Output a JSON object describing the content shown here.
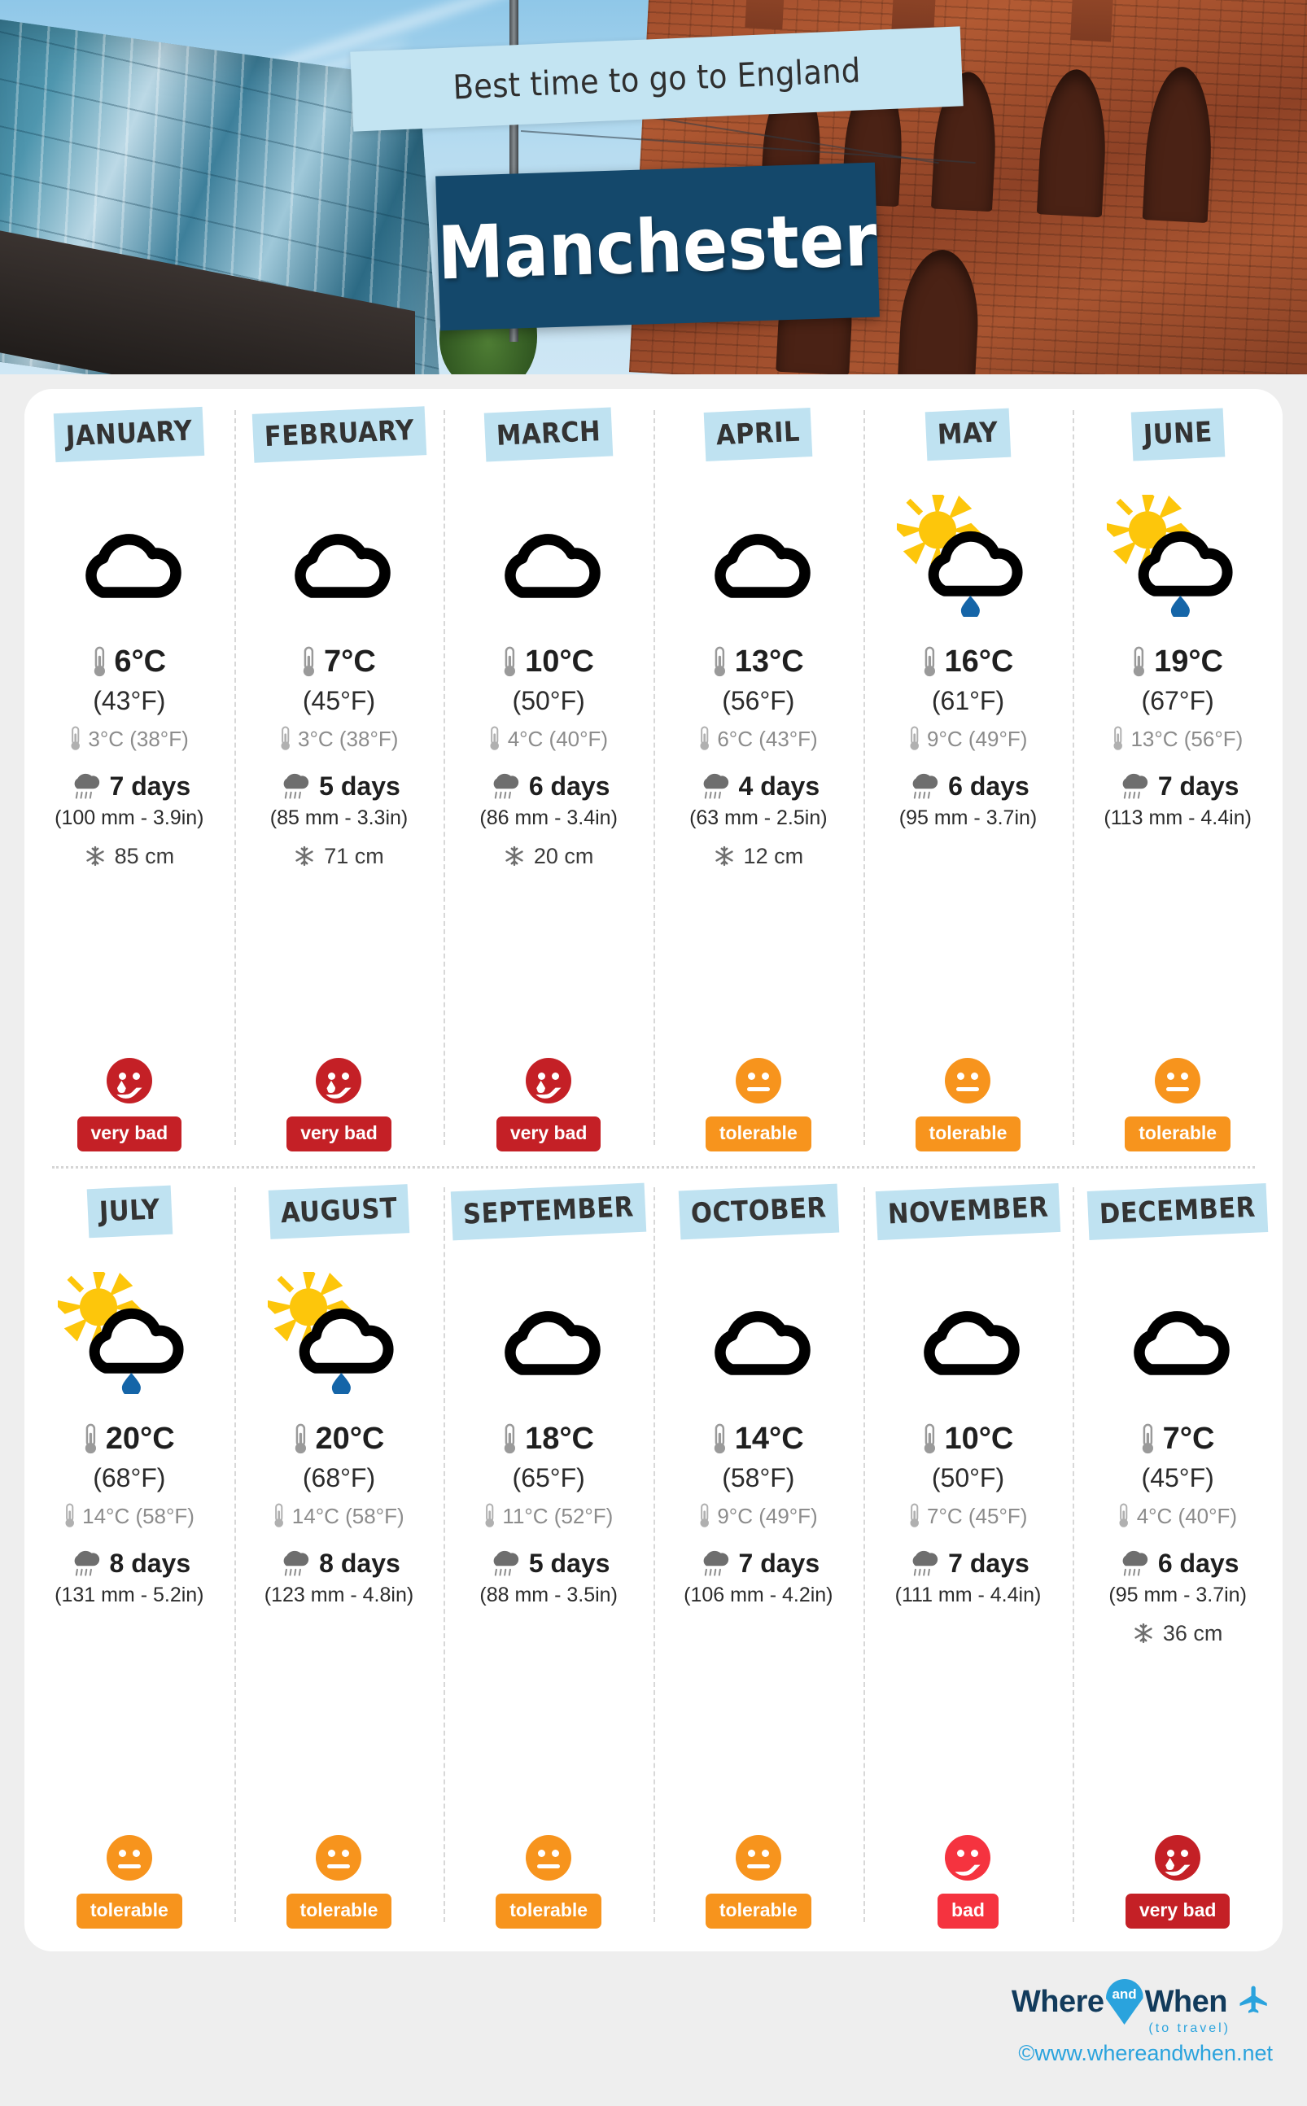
{
  "hero": {
    "subtitle": "Best time to go to England",
    "city": "Manchester"
  },
  "colors": {
    "accent_blue": "#bfe2f1",
    "band_dark_blue": "#14486b",
    "tolerable_orange": "#f7941d",
    "bad_red": "#f5333f",
    "very_bad_red": "#c42026",
    "raindrop_blue": "#1565a8",
    "sun_yellow": "#fdc60b",
    "logo_blue": "#2aa3dd",
    "logo_navy": "#123b5c"
  },
  "icons": {
    "thermometer": "thermometer-icon",
    "thermometer_low": "thermometer-low-icon",
    "rain_cloud": "rain-cloud-icon",
    "snowflake": "snowflake-icon",
    "cloud": "cloud-icon",
    "sun_cloud_rain": "sun-cloud-rain-icon"
  },
  "months": [
    {
      "name": "JANUARY",
      "weather_icon": "cloud",
      "temp_high_c": "6°C",
      "temp_high_f": "(43°F)",
      "temp_low": "3°C (38°F)",
      "rain_days": "7 days",
      "rain_amount": "(100 mm - 3.9in)",
      "snow": "85 cm",
      "rating": "very bad",
      "rating_face": "crying",
      "rating_color": "#c42026"
    },
    {
      "name": "FEBRUARY",
      "weather_icon": "cloud",
      "temp_high_c": "7°C",
      "temp_high_f": "(45°F)",
      "temp_low": "3°C (38°F)",
      "rain_days": "5 days",
      "rain_amount": "(85 mm - 3.3in)",
      "snow": "71 cm",
      "rating": "very bad",
      "rating_face": "crying",
      "rating_color": "#c42026"
    },
    {
      "name": "MARCH",
      "weather_icon": "cloud",
      "temp_high_c": "10°C",
      "temp_high_f": "(50°F)",
      "temp_low": "4°C (40°F)",
      "rain_days": "6 days",
      "rain_amount": "(86 mm - 3.4in)",
      "snow": "20 cm",
      "rating": "very bad",
      "rating_face": "crying",
      "rating_color": "#c42026"
    },
    {
      "name": "APRIL",
      "weather_icon": "cloud",
      "temp_high_c": "13°C",
      "temp_high_f": "(56°F)",
      "temp_low": "6°C (43°F)",
      "rain_days": "4 days",
      "rain_amount": "(63 mm - 2.5in)",
      "snow": "12 cm",
      "rating": "tolerable",
      "rating_face": "neutral",
      "rating_color": "#f7941d"
    },
    {
      "name": "MAY",
      "weather_icon": "sun_cloud_rain",
      "temp_high_c": "16°C",
      "temp_high_f": "(61°F)",
      "temp_low": "9°C (49°F)",
      "rain_days": "6 days",
      "rain_amount": "(95 mm - 3.7in)",
      "snow": "",
      "rating": "tolerable",
      "rating_face": "neutral",
      "rating_color": "#f7941d"
    },
    {
      "name": "JUNE",
      "weather_icon": "sun_cloud_rain",
      "temp_high_c": "19°C",
      "temp_high_f": "(67°F)",
      "temp_low": "13°C (56°F)",
      "rain_days": "7 days",
      "rain_amount": "(113 mm - 4.4in)",
      "snow": "",
      "rating": "tolerable",
      "rating_face": "neutral",
      "rating_color": "#f7941d"
    },
    {
      "name": "JULY",
      "weather_icon": "sun_cloud_rain",
      "temp_high_c": "20°C",
      "temp_high_f": "(68°F)",
      "temp_low": "14°C (58°F)",
      "rain_days": "8 days",
      "rain_amount": "(131 mm - 5.2in)",
      "snow": "",
      "rating": "tolerable",
      "rating_face": "neutral",
      "rating_color": "#f7941d"
    },
    {
      "name": "AUGUST",
      "weather_icon": "sun_cloud_rain",
      "temp_high_c": "20°C",
      "temp_high_f": "(68°F)",
      "temp_low": "14°C (58°F)",
      "rain_days": "8 days",
      "rain_amount": "(123 mm - 4.8in)",
      "snow": "",
      "rating": "tolerable",
      "rating_face": "neutral",
      "rating_color": "#f7941d"
    },
    {
      "name": "SEPTEMBER",
      "weather_icon": "cloud",
      "temp_high_c": "18°C",
      "temp_high_f": "(65°F)",
      "temp_low": "11°C (52°F)",
      "rain_days": "5 days",
      "rain_amount": "(88 mm - 3.5in)",
      "snow": "",
      "rating": "tolerable",
      "rating_face": "neutral",
      "rating_color": "#f7941d"
    },
    {
      "name": "OCTOBER",
      "weather_icon": "cloud",
      "temp_high_c": "14°C",
      "temp_high_f": "(58°F)",
      "temp_low": "9°C (49°F)",
      "rain_days": "7 days",
      "rain_amount": "(106 mm - 4.2in)",
      "snow": "",
      "rating": "tolerable",
      "rating_face": "neutral",
      "rating_color": "#f7941d"
    },
    {
      "name": "NOVEMBER",
      "weather_icon": "cloud",
      "temp_high_c": "10°C",
      "temp_high_f": "(50°F)",
      "temp_low": "7°C (45°F)",
      "rain_days": "7 days",
      "rain_amount": "(111 mm - 4.4in)",
      "snow": "",
      "rating": "bad",
      "rating_face": "frown",
      "rating_color": "#f5333f"
    },
    {
      "name": "DECEMBER",
      "weather_icon": "cloud",
      "temp_high_c": "7°C",
      "temp_high_f": "(45°F)",
      "temp_low": "4°C (40°F)",
      "rain_days": "6 days",
      "rain_amount": "(95 mm - 3.7in)",
      "snow": "36 cm",
      "rating": "very bad",
      "rating_face": "crying",
      "rating_color": "#c42026"
    }
  ],
  "footer": {
    "logo_where": "Where",
    "logo_and": "and",
    "logo_when": "When",
    "logo_tagline": "(to travel)",
    "url": "©www.whereandwhen.net"
  }
}
